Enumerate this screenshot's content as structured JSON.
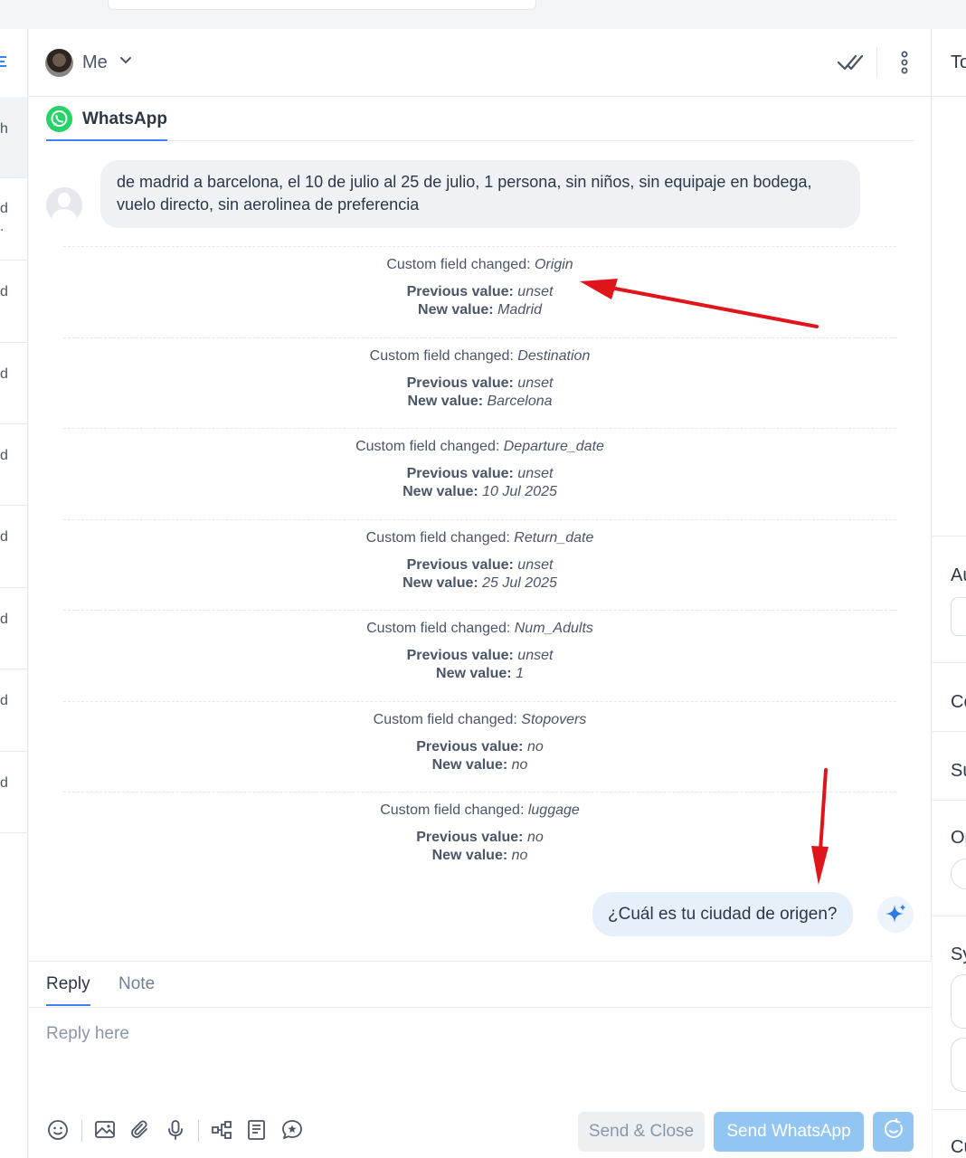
{
  "header": {
    "user_label": "Me"
  },
  "channel_tab": {
    "label": "WhatsApp"
  },
  "left_list": {
    "visible_fragments": [
      "h",
      "d",
      ".",
      "d",
      "d",
      "d",
      "d",
      "d",
      "d",
      "d"
    ]
  },
  "incoming_message": {
    "text": "de madrid a barcelona, el 10 de julio al 25 de julio, 1 persona, sin niños, sin equipaje en bodega, vuelo directo, sin aerolinea de preferencia"
  },
  "events": [
    {
      "prefix": "Custom field changed:",
      "field": "Origin",
      "prev_label": "Previous value:",
      "prev": "unset",
      "new_label": "New value:",
      "new": "Madrid"
    },
    {
      "prefix": "Custom field changed:",
      "field": "Destination",
      "prev_label": "Previous value:",
      "prev": "unset",
      "new_label": "New value:",
      "new": "Barcelona"
    },
    {
      "prefix": "Custom field changed:",
      "field": "Departure_date",
      "prev_label": "Previous value:",
      "prev": "unset",
      "new_label": "New value:",
      "new": "10 Jul 2025"
    },
    {
      "prefix": "Custom field changed:",
      "field": "Return_date",
      "prev_label": "Previous value:",
      "prev": "unset",
      "new_label": "New value:",
      "new": "25 Jul 2025"
    },
    {
      "prefix": "Custom field changed:",
      "field": "Num_Adults",
      "prev_label": "Previous value:",
      "prev": "unset",
      "new_label": "New value:",
      "new": "1"
    },
    {
      "prefix": "Custom field changed:",
      "field": "Stopovers",
      "prev_label": "Previous value:",
      "prev": "no",
      "new_label": "New value:",
      "new": "no"
    },
    {
      "prefix": "Custom field changed:",
      "field": "luggage",
      "prev_label": "Previous value:",
      "prev": "no",
      "new_label": "New value:",
      "new": "no"
    }
  ],
  "outgoing_message": {
    "text": "¿Cuál es tu ciudad de origen?"
  },
  "composer": {
    "tabs": [
      "Reply",
      "Note"
    ],
    "placeholder": "Reply here",
    "send_close_label": "Send & Close",
    "send_label": "Send WhatsApp"
  },
  "right_panel": {
    "fragments": [
      "To",
      "Au",
      "Co",
      "Su",
      "Op",
      "Sy",
      "Cu"
    ]
  },
  "colors": {
    "accent": "#3b82f6",
    "whatsapp": "#25d366",
    "annotation_arrow": "#e0151b",
    "send_button": "#93c5f3"
  }
}
